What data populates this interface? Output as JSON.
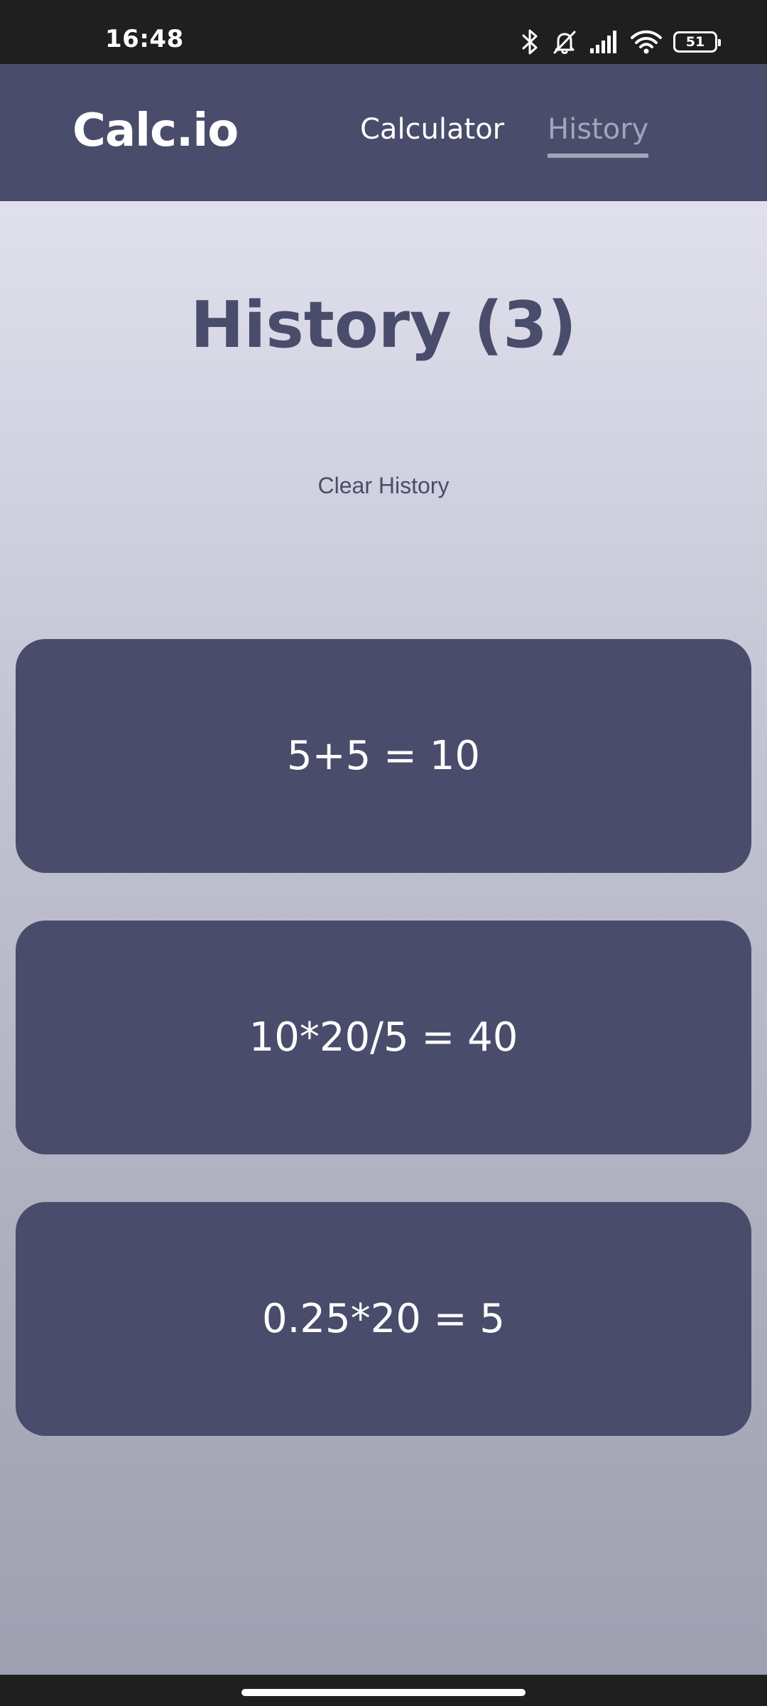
{
  "status_bar": {
    "time": "16:48",
    "battery_level": "51",
    "icons": [
      "bluetooth-icon",
      "bell-off-icon",
      "signal-icon",
      "wifi-icon",
      "battery-icon"
    ]
  },
  "header": {
    "brand": "Calc.io",
    "nav": {
      "calculator": "Calculator",
      "history": "History"
    },
    "active_tab": "History"
  },
  "main": {
    "title": "History (3)",
    "clear_label": "Clear History",
    "history_items": [
      "5+5 = 10",
      "10*20/5 = 40",
      "0.25*20 = 5"
    ]
  },
  "colors": {
    "primary": "#4a4c6b",
    "nav_inactive": "#a3a4b9",
    "background_top": "#e0e0ed",
    "background_bottom": "#9e9fb0",
    "system_bar": "#1f1f1f"
  }
}
